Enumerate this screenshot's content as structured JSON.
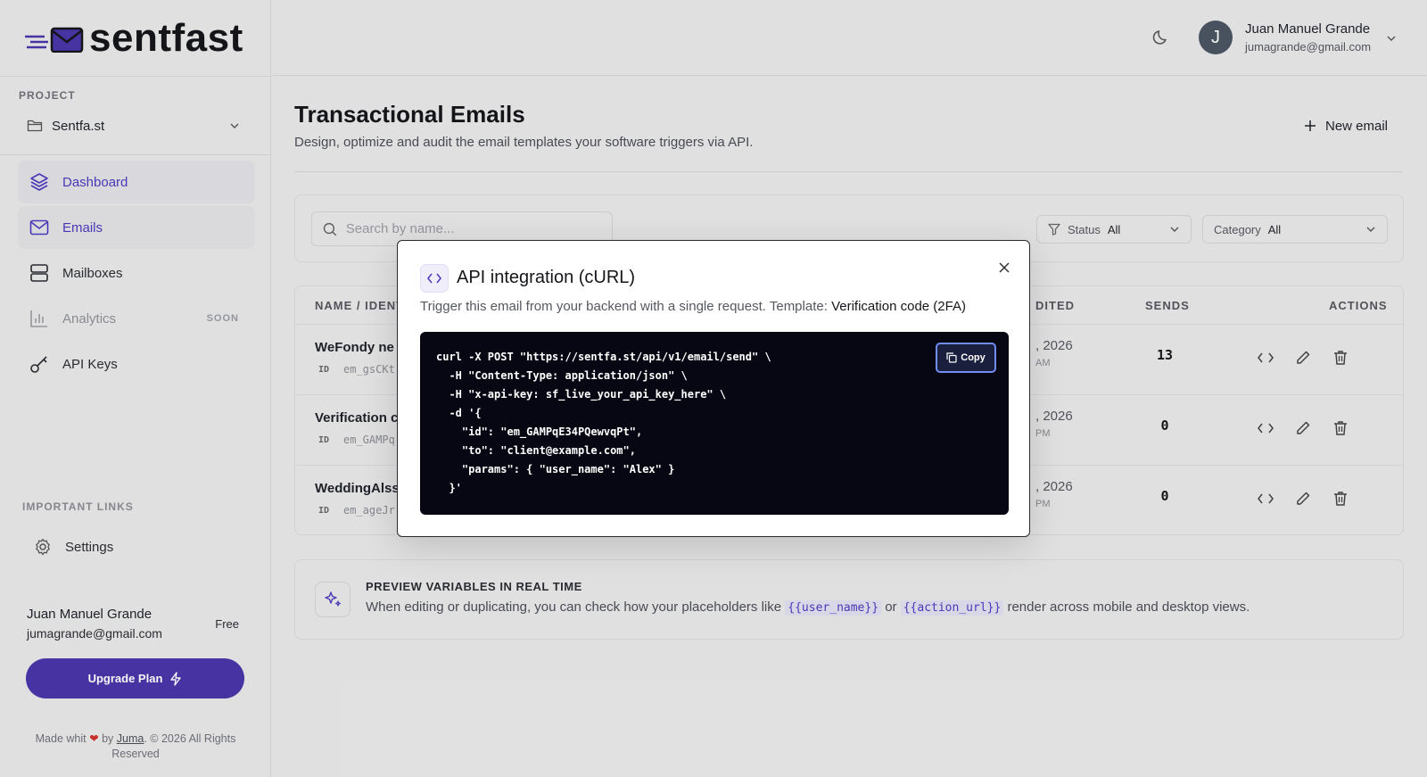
{
  "brand": {
    "name": "sentfast",
    "accent": "#4a35a8"
  },
  "sidebar": {
    "project_label": "PROJECT",
    "project_name": "Sentfa.st",
    "nav": [
      {
        "label": "Dashboard",
        "icon": "layers-icon"
      },
      {
        "label": "Emails",
        "icon": "mail-icon"
      },
      {
        "label": "Mailboxes",
        "icon": "server-icon"
      },
      {
        "label": "Analytics",
        "icon": "bar-chart-icon",
        "badge": "SOON"
      },
      {
        "label": "API Keys",
        "icon": "key-icon"
      }
    ],
    "links_label": "IMPORTANT LINKS",
    "settings_label": "Settings",
    "user": {
      "name": "Juan Manuel Grande",
      "email": "jumagrande@gmail.com",
      "plan": "Free"
    },
    "upgrade_label": "Upgrade Plan",
    "footer": {
      "prefix": "Made whit",
      "by": "by",
      "author": "Juma",
      "suffix": ". © 2026 All Rights Reserved"
    }
  },
  "header": {
    "user_initial": "J",
    "user_name": "Juan Manuel Grande",
    "user_email": "jumagrande@gmail.com"
  },
  "main": {
    "title": "Transactional Emails",
    "subtitle": "Design, optimize and audit the email templates your software triggers via API.",
    "new_email_label": "New email",
    "search_placeholder": "Search by name...",
    "filters": {
      "status_label": "Status",
      "status_value": "All",
      "category_label": "Category",
      "category_value": "All"
    },
    "table": {
      "headers": {
        "name": "NAME / IDENT",
        "edited": "DITED",
        "sends": "SENDS",
        "actions": "ACTIONS"
      },
      "rows": [
        {
          "name": "WeFondy ne",
          "id_tag": "ID",
          "id": "em_gsCKt",
          "date": ", 2026",
          "time": "AM",
          "sends": "13"
        },
        {
          "name": "Verification c",
          "id_tag": "ID",
          "id": "em_GAMPq",
          "date": ", 2026",
          "time": "PM",
          "sends": "0"
        },
        {
          "name": "WeddingAlss",
          "id_tag": "ID",
          "id": "em_ageJr",
          "date": ", 2026",
          "time": "PM",
          "sends": "0"
        }
      ]
    },
    "info": {
      "title": "PREVIEW VARIABLES IN REAL TIME",
      "text_before": "When editing or duplicating, you can check how your placeholders like",
      "var1": "{{user_name}}",
      "text_or": "or",
      "var2": "{{action_url}}",
      "text_after": "render across mobile and desktop views."
    }
  },
  "modal": {
    "title": "API integration (cURL)",
    "subtitle": "Trigger this email from your backend with a single request. Template:",
    "template_name": "Verification code (2FA)",
    "copy_label": "Copy",
    "code": "curl -X POST \"https://sentfa.st/api/v1/email/send\" \\\n  -H \"Content-Type: application/json\" \\\n  -H \"x-api-key: sf_live_your_api_key_here\" \\\n  -d '{\n    \"id\": \"em_GAMPqE34PQewvqPt\",\n    \"to\": \"client@example.com\",\n    \"params\": { \"user_name\": \"Alex\" }\n  }'"
  }
}
